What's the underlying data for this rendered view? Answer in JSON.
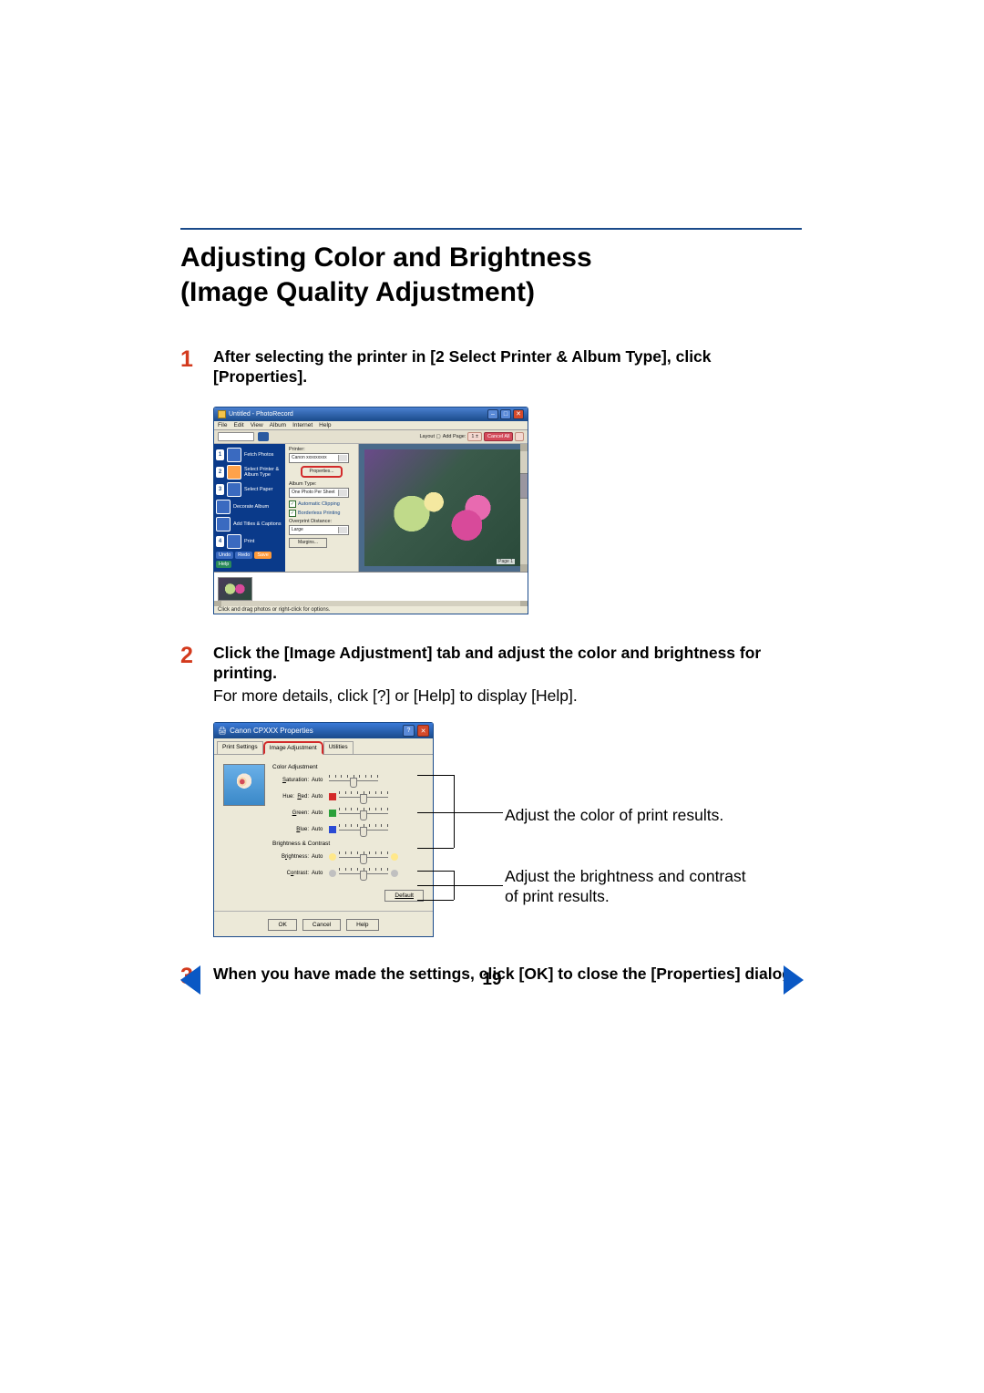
{
  "heading_line1": "Adjusting Color and Brightness",
  "heading_line2": "(Image Quality Adjustment)",
  "steps": {
    "1": {
      "num": "1",
      "bold": "After selecting the printer in [2 Select Printer & Album Type], click [Properties]."
    },
    "2": {
      "num": "2",
      "bold": "Click the [Image Adjustment] tab and adjust the color and brightness for printing.",
      "text": "For more details, click [?] or [Help] to display [Help]."
    },
    "3": {
      "num": "3",
      "bold": "When you have made the settings, click [OK] to close the [Properties] dialog."
    }
  },
  "fig1": {
    "title": "Untitled - PhotoRecord",
    "menu": [
      "File",
      "Edit",
      "View",
      "Album",
      "Internet",
      "Help"
    ],
    "toolbar_right": {
      "add_page": "Add Page:",
      "cancel": "Cancel All"
    },
    "side": {
      "s1": "Fetch Photos",
      "s2": "Select Printer & Album Type",
      "s3": "Select Paper",
      "s4": "Decorate Album",
      "s5": "Add Titles & Captions",
      "s6": "Print"
    },
    "side_chips": {
      "undo": "Undo",
      "redo": "Redo",
      "save": "Save",
      "help": "Help"
    },
    "mid": {
      "printer": "Printer:",
      "printer_val": "Canon xxxxxxxxx",
      "properties": "Properties...",
      "album_type": "Album Type:",
      "album_type_val": "One Photo Per Sheet",
      "auto_clip": "Automatic Clipping",
      "borderless": "Borderless Printing",
      "overprint": "Overprint Distance:",
      "overprint_val": "Large",
      "margins": "Margins..."
    },
    "page_label": "Page 1",
    "status": "Click and drag photos or right-click for options."
  },
  "fig2": {
    "title": "Canon CPXXX Properties",
    "tabs": {
      "t1": "Print Settings",
      "t2": "Image Adjustment",
      "t3": "Utilities"
    },
    "color_adj": "Color Adjustment",
    "rows": {
      "sat": {
        "lbl": "Saturation:",
        "auto": "Auto"
      },
      "hue": {
        "lbl": "Hue:  Red:",
        "auto": "Auto"
      },
      "green": {
        "lbl": "Green:",
        "auto": "Auto"
      },
      "blue": {
        "lbl": "Blue:",
        "auto": "Auto"
      }
    },
    "bright_group": "Brightness & Contrast",
    "brightness": {
      "lbl": "Brightness:",
      "auto": "Auto"
    },
    "contrast": {
      "lbl": "Contrast:",
      "auto": "Auto"
    },
    "default": "Default",
    "ok": "OK",
    "cancel": "Cancel",
    "help": "Help"
  },
  "callouts": {
    "c1": "Adjust the color of print results.",
    "c2": "Adjust the brightness and contrast of print results."
  },
  "pager": {
    "page": "19"
  }
}
